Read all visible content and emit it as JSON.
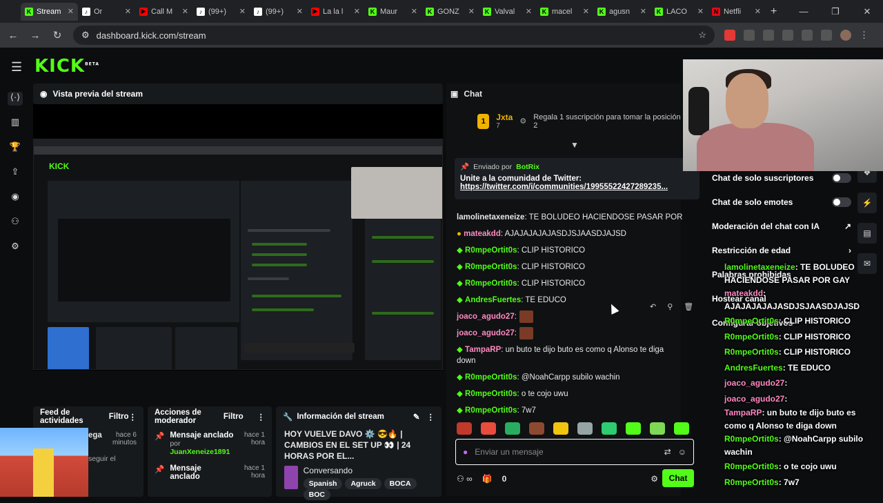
{
  "browser": {
    "tabs": [
      {
        "label": "Stream",
        "color": "#53fc18",
        "glyph": "K",
        "active": true
      },
      {
        "label": "Or",
        "color": "#ffffff",
        "glyph": "♪"
      },
      {
        "label": "Call M",
        "color": "#ff0000",
        "glyph": "▶"
      },
      {
        "label": "(99+)",
        "color": "#ffffff",
        "glyph": "♪"
      },
      {
        "label": "(99+)",
        "color": "#ffffff",
        "glyph": "♪"
      },
      {
        "label": "La la l",
        "color": "#ff0000",
        "glyph": "▶"
      },
      {
        "label": "Maur",
        "color": "#53fc18",
        "glyph": "K"
      },
      {
        "label": "GONZ",
        "color": "#53fc18",
        "glyph": "K"
      },
      {
        "label": "Valval",
        "color": "#53fc18",
        "glyph": "K"
      },
      {
        "label": "macel",
        "color": "#53fc18",
        "glyph": "K"
      },
      {
        "label": "agusn",
        "color": "#53fc18",
        "glyph": "K"
      },
      {
        "label": "LACO",
        "color": "#53fc18",
        "glyph": "K"
      },
      {
        "label": "Netfli",
        "color": "#e50914",
        "glyph": "N"
      }
    ],
    "url": "dashboard.kick.com/stream"
  },
  "logo": {
    "text": "KICK",
    "badge": "BETA"
  },
  "preview": {
    "title": "Vista previa del stream"
  },
  "chat": {
    "title": "Chat",
    "gift": {
      "rank": "1",
      "name": "Jxta",
      "count": "7",
      "text": "Regala 1 suscripción para tomar la posición 2"
    },
    "pinned": {
      "sent_by": "Enviado por",
      "sender": "BotRix",
      "message": "Unite a la comunidad de Twitter:",
      "link": "https://twitter.com/i/communities/19955522427289235..."
    },
    "messages": [
      {
        "user": "lamolinetaxeneize",
        "color": "#e8e8e8",
        "text": ": TE BOLUDEO HACIENDOSE PASAR POR GAY"
      },
      {
        "user": "mateakdd",
        "color": "#ff8ac2",
        "text": ": AJAJAJAJAJASDJSJAASDJAJSD"
      },
      {
        "user": "R0mpeOrtit0s",
        "color": "#53fc18",
        "text": ": CLIP HISTORICO"
      },
      {
        "user": "R0mpeOrtit0s",
        "color": "#53fc18",
        "text": ": CLIP HISTORICO"
      },
      {
        "user": "R0mpeOrtit0s",
        "color": "#53fc18",
        "text": ": CLIP HISTORICO"
      },
      {
        "user": "AndresFuertes",
        "color": "#53fc18",
        "text": ": TE EDUCO"
      },
      {
        "user": "joaco_agudo27",
        "color": "#ff8ac2",
        "text": ":"
      },
      {
        "user": "joaco_agudo27",
        "color": "#ff8ac2",
        "text": ":"
      },
      {
        "user": "TampaRP",
        "color": "#ff8ac2",
        "text": ": un buto te dijo buto es como q Alonso te diga down"
      },
      {
        "user": "R0mpeOrtit0s",
        "color": "#53fc18",
        "text": ": @NoahCarpp subilo wachin"
      },
      {
        "user": "R0mpeOrtit0s",
        "color": "#53fc18",
        "text": ": o te cojo uwu"
      },
      {
        "user": "R0mpeOrtit0s",
        "color": "#53fc18",
        "text": ": 7w7"
      }
    ],
    "input_placeholder": "Enviar un mensaje",
    "count": "0",
    "send_label": "Chat"
  },
  "settings": [
    {
      "label": "Chat de solo suscriptores",
      "control": "toggle"
    },
    {
      "label": "Chat de solo emotes",
      "control": "toggle"
    },
    {
      "label": "Moderación del chat con IA",
      "control": "external"
    },
    {
      "label": "Restricción de edad",
      "control": "chevron"
    },
    {
      "label": "Palabras prohibidas",
      "control": ""
    },
    {
      "label": "Hostear canal",
      "control": ""
    },
    {
      "label": "Configurar objetivos",
      "control": ""
    }
  ],
  "overlay_chat": [
    {
      "user": "lamolinetaxeneize",
      "text": ": TE BOLUDEO HACIENDOSE PASAR POR GAY",
      "pink": false
    },
    {
      "user": "mateakdd",
      "text": ": AJAJAJAJAJASDJSJAASDJAJSD",
      "pink": true
    },
    {
      "user": "R0mpeOrtit0s",
      "text": ": CLIP HISTORICO",
      "pink": false
    },
    {
      "user": "R0mpeOrtit0s",
      "text": ": CLIP HISTORICO",
      "pink": false
    },
    {
      "user": "R0mpeOrtit0s",
      "text": ": CLIP HISTORICO",
      "pink": false
    },
    {
      "user": "AndresFuertes",
      "text": ": TE EDUCO",
      "pink": false
    },
    {
      "user": "joaco_agudo27",
      "text": ":",
      "pink": true
    },
    {
      "user": "joaco_agudo27",
      "text": ":",
      "pink": true
    },
    {
      "user": "TampaRP",
      "text": ": un buto te dijo buto es como q Alonso te diga down",
      "pink": true
    },
    {
      "user": "R0mpeOrtit0s",
      "text": ": @NoahCarpp subilo wachin",
      "pink": false
    },
    {
      "user": "R0mpeOrtit0s",
      "text": ": o te cojo uwu",
      "pink": false
    },
    {
      "user": "R0mpeOrtit0s",
      "text": ": 7w7",
      "pink": false
    }
  ],
  "activity": {
    "title": "Feed de actividades",
    "filter": "Filtro",
    "item_text": "ega",
    "time": "hace 6 minutos",
    "sub": "seguir el"
  },
  "mod": {
    "title": "Acciones de moderador",
    "filter": "Filtro",
    "items": [
      {
        "title": "Mensaje anclado",
        "by": "por",
        "user": "JuanXeneize1891",
        "time": "hace 1 hora"
      },
      {
        "title": "Mensaje anclado",
        "by": "",
        "user": "",
        "time": "hace 1 hora"
      }
    ]
  },
  "info": {
    "title": "Información del stream",
    "stream_title": "HOY VUELVE DAVO ⚙️ 😎🔥 | CAMBIOS EN EL SET UP 👀 | 24 HORAS POR EL...",
    "category": "Conversando",
    "tags": [
      "Spanish",
      "Agruck",
      "BOCA",
      "BOC"
    ]
  },
  "colors": {
    "accent": "#53fc18",
    "bg": "#0b0d0f",
    "panel": "#171a1d"
  }
}
